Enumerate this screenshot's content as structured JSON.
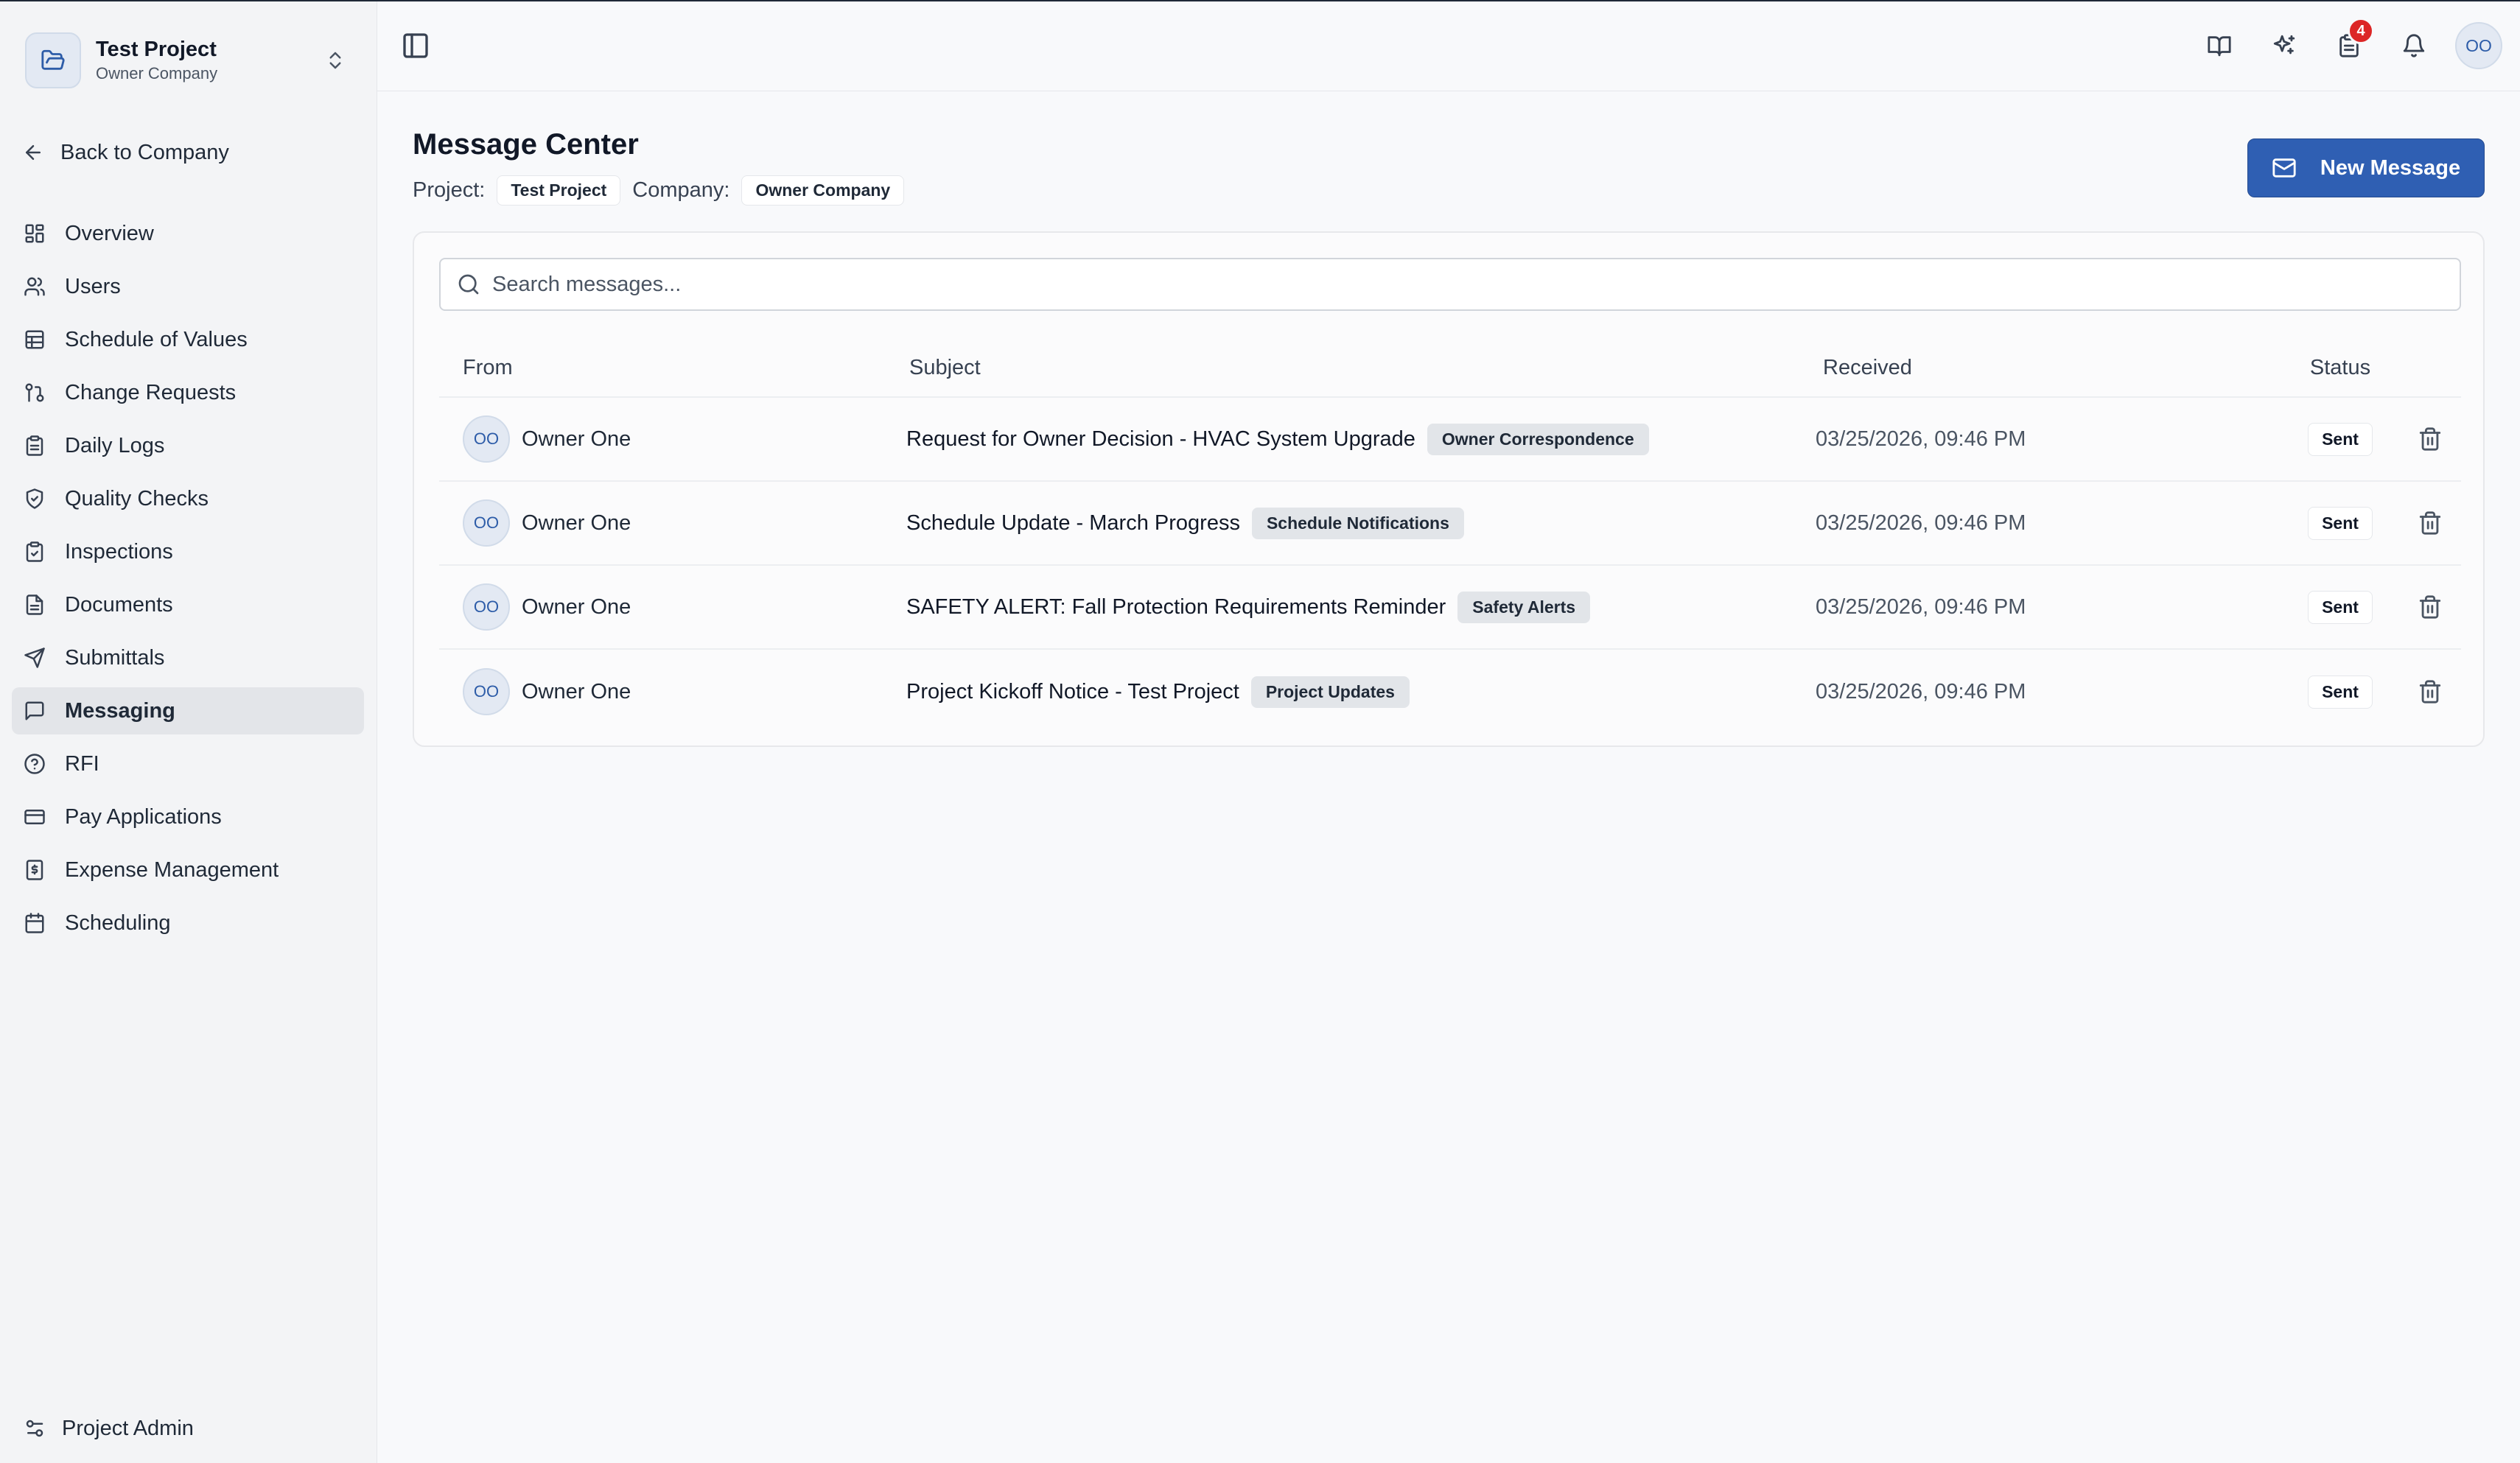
{
  "sidebar": {
    "project_name": "Test Project",
    "project_company": "Owner Company",
    "back_label": "Back to Company",
    "items": [
      {
        "label": "Overview",
        "icon": "overview-grid-icon"
      },
      {
        "label": "Users",
        "icon": "users-icon"
      },
      {
        "label": "Schedule of Values",
        "icon": "table-icon"
      },
      {
        "label": "Change Requests",
        "icon": "git-branch-icon"
      },
      {
        "label": "Daily Logs",
        "icon": "clipboard-icon"
      },
      {
        "label": "Quality Checks",
        "icon": "shield-check-icon"
      },
      {
        "label": "Inspections",
        "icon": "clipboard-check-icon"
      },
      {
        "label": "Documents",
        "icon": "document-icon"
      },
      {
        "label": "Submittals",
        "icon": "send-icon"
      },
      {
        "label": "Messaging",
        "icon": "message-icon",
        "active": true
      },
      {
        "label": "RFI",
        "icon": "question-circle-icon"
      },
      {
        "label": "Pay Applications",
        "icon": "credit-card-icon"
      },
      {
        "label": "Expense Management",
        "icon": "receipt-dollar-icon"
      },
      {
        "label": "Scheduling",
        "icon": "calendar-icon"
      }
    ],
    "admin_label": "Project Admin"
  },
  "topbar": {
    "notification_count": "4",
    "user_initials": "OO"
  },
  "page": {
    "title": "Message Center",
    "project_label": "Project:",
    "project_value": "Test Project",
    "company_label": "Company:",
    "company_value": "Owner Company",
    "new_message_label": "New Message"
  },
  "search": {
    "placeholder": "Search messages..."
  },
  "table": {
    "headers": {
      "from": "From",
      "subject": "Subject",
      "received": "Received",
      "status": "Status"
    },
    "rows": [
      {
        "initials": "OO",
        "from": "Owner One",
        "subject": "Request for Owner Decision - HVAC System Upgrade",
        "category": "Owner Correspondence",
        "received": "03/25/2026, 09:46 PM",
        "status": "Sent"
      },
      {
        "initials": "OO",
        "from": "Owner One",
        "subject": "Schedule Update - March Progress",
        "category": "Schedule Notifications",
        "received": "03/25/2026, 09:46 PM",
        "status": "Sent"
      },
      {
        "initials": "OO",
        "from": "Owner One",
        "subject": "SAFETY ALERT: Fall Protection Requirements Reminder",
        "category": "Safety Alerts",
        "received": "03/25/2026, 09:46 PM",
        "status": "Sent"
      },
      {
        "initials": "OO",
        "from": "Owner One",
        "subject": "Project Kickoff Notice - Test Project",
        "category": "Project Updates",
        "received": "03/25/2026, 09:46 PM",
        "status": "Sent"
      }
    ]
  },
  "colors": {
    "primary": "#2f5fb3",
    "badge": "#dc2626",
    "avatar_bg": "#e3e9f3",
    "avatar_text": "#2d5ca8"
  }
}
